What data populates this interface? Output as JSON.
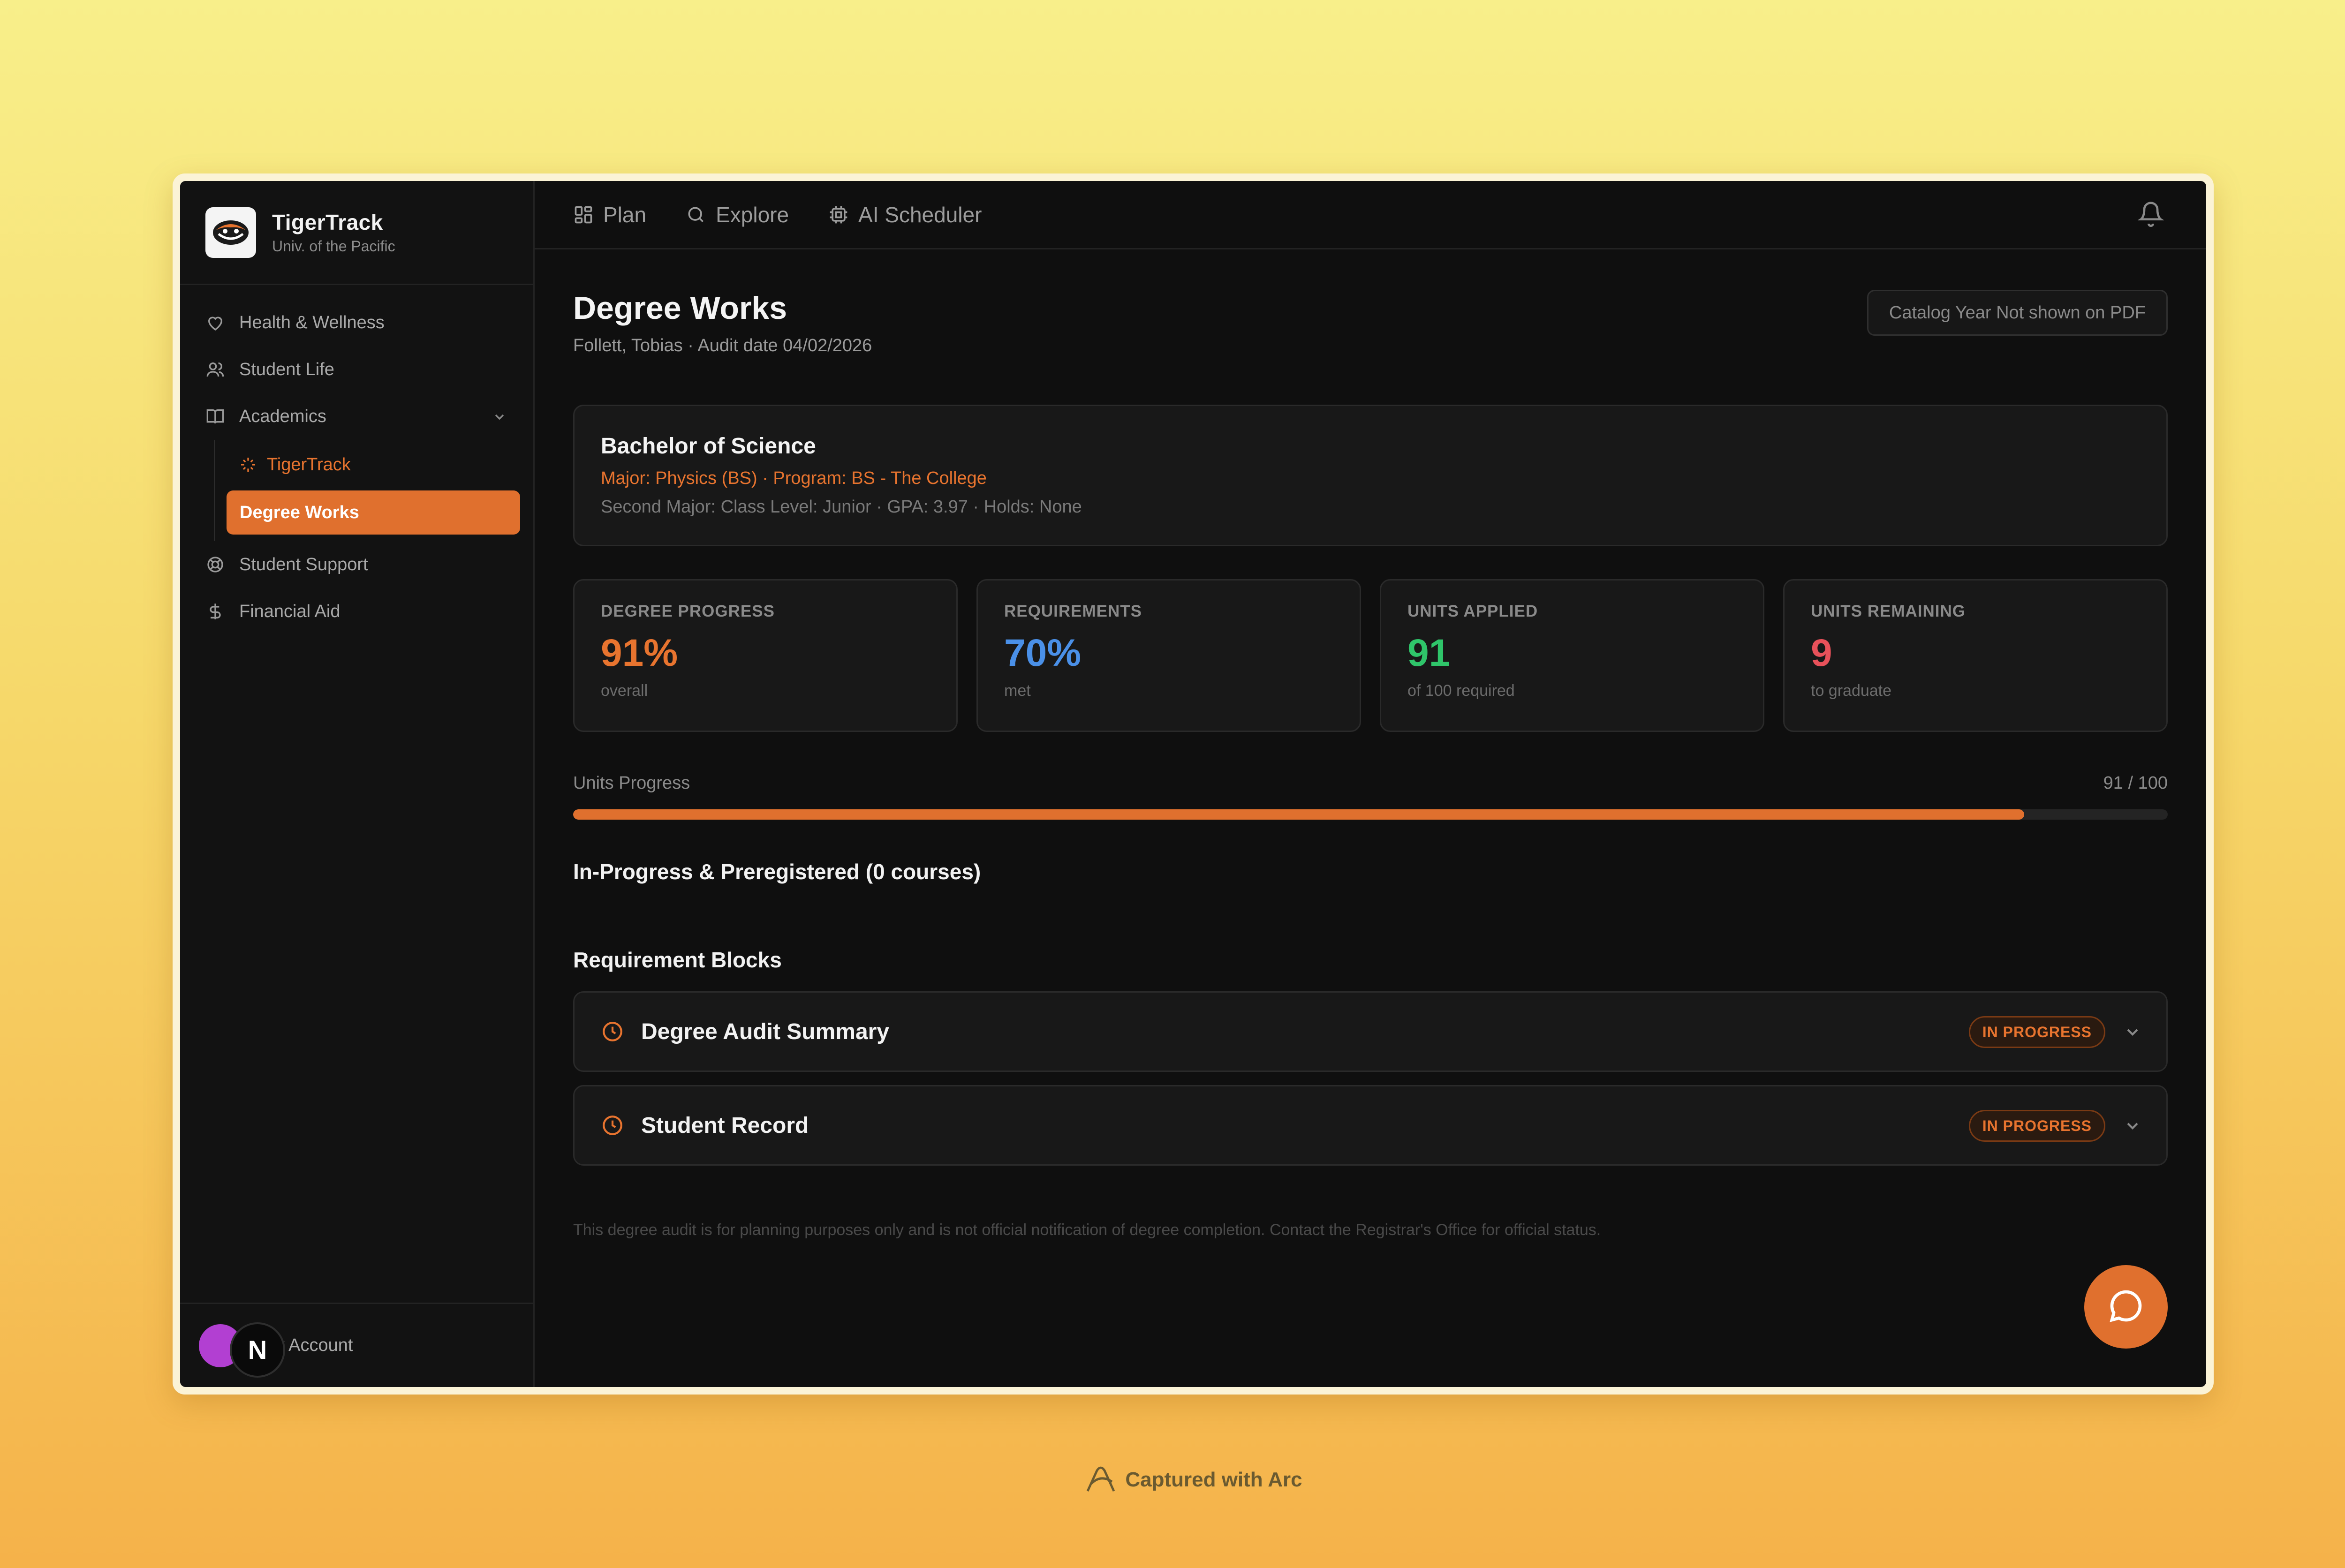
{
  "app": {
    "title": "TigerTrack",
    "subtitle": "Univ. of the Pacific"
  },
  "sidebar": {
    "items": [
      {
        "label": "Health & Wellness",
        "icon": "heart-icon"
      },
      {
        "label": "Student Life",
        "icon": "users-icon"
      },
      {
        "label": "Academics",
        "icon": "book-icon"
      },
      {
        "label": "Student Support",
        "icon": "lifebuoy-icon"
      },
      {
        "label": "Financial Aid",
        "icon": "dollar-icon"
      }
    ],
    "academics_sub": [
      {
        "label": "TigerTrack",
        "icon": "sparkle-icon"
      },
      {
        "label": "Degree Works"
      }
    ],
    "account_label": "My Account",
    "badge_letter": "N"
  },
  "topbar": {
    "tabs": [
      {
        "label": "Plan",
        "icon": "grid-icon"
      },
      {
        "label": "Explore",
        "icon": "search-icon"
      },
      {
        "label": "AI Scheduler",
        "icon": "cpu-icon"
      }
    ]
  },
  "page": {
    "title": "Degree Works",
    "subtitle": "Follett, Tobias · Audit date 04/02/2026",
    "catalog_button": "Catalog Year Not shown on PDF"
  },
  "degree": {
    "title": "Bachelor of Science",
    "major_line": "Major: Physics (BS) · Program: BS - The College",
    "meta_line": "Second Major: Class Level: Junior · GPA: 3.97 · Holds: None"
  },
  "stats": [
    {
      "label": "DEGREE PROGRESS",
      "value": "91%",
      "sub": "overall",
      "color": "#e8742f"
    },
    {
      "label": "REQUIREMENTS",
      "value": "70%",
      "sub": "met",
      "color": "#4a90e8"
    },
    {
      "label": "UNITS APPLIED",
      "value": "91",
      "sub": "of 100 required",
      "color": "#2fc56a"
    },
    {
      "label": "UNITS REMAINING",
      "value": "9",
      "sub": "to graduate",
      "color": "#e8515a"
    }
  ],
  "progress": {
    "label": "Units Progress",
    "value_text": "91 / 100",
    "fraction": 0.91
  },
  "sections": {
    "in_progress_heading": "In-Progress & Preregistered (0 courses)",
    "requirements_heading": "Requirement Blocks"
  },
  "blocks": [
    {
      "title": "Degree Audit Summary",
      "status": "IN PROGRESS"
    },
    {
      "title": "Student Record",
      "status": "IN PROGRESS"
    }
  ],
  "disclaimer": "This degree audit is for planning purposes only and is not official notification of degree completion. Contact the Registrar's Office for official status.",
  "capture": {
    "caption": "Captured with Arc"
  },
  "colors": {
    "accent": "#e0702e"
  }
}
